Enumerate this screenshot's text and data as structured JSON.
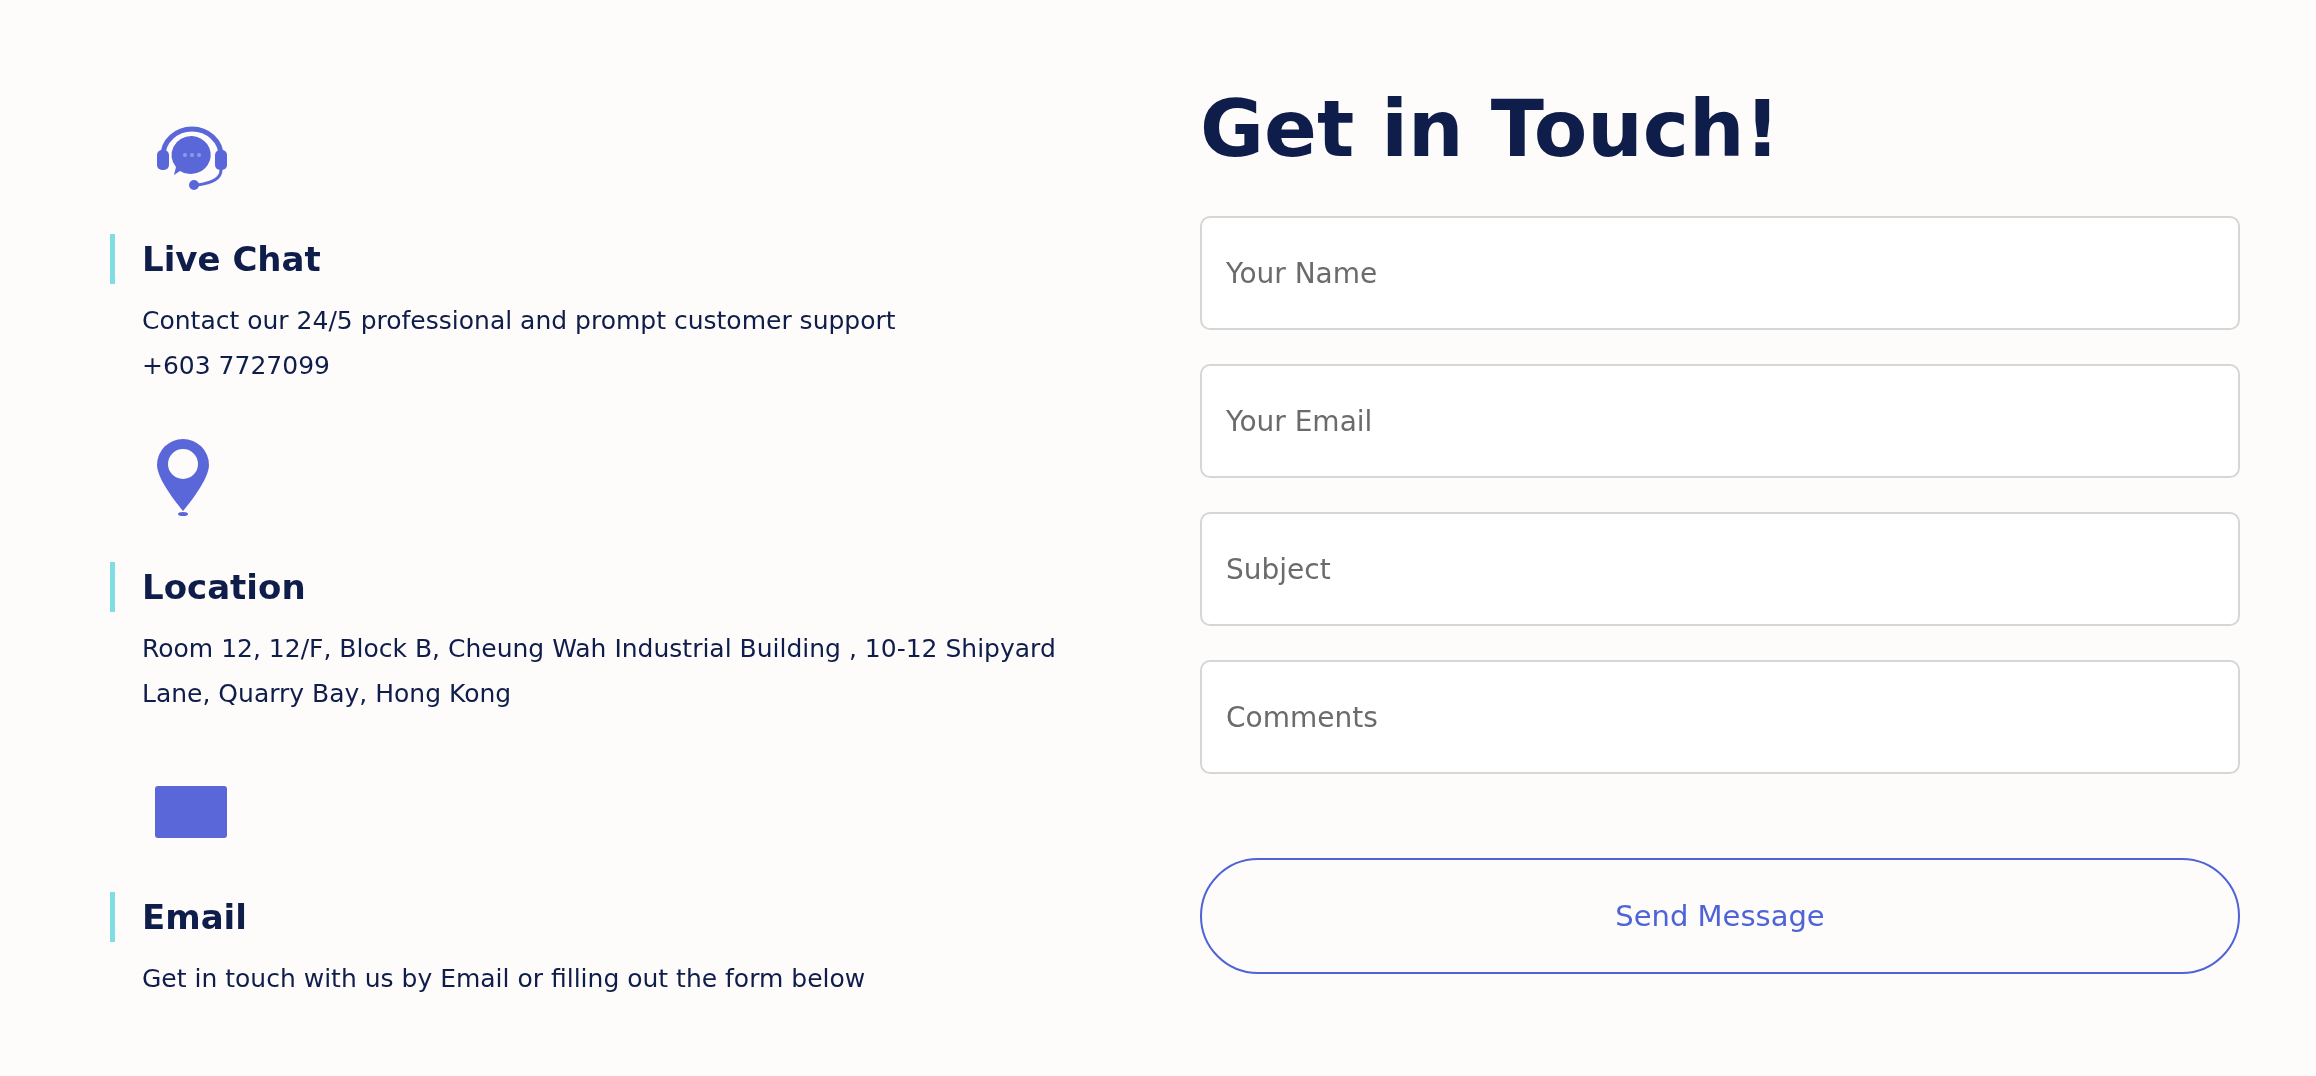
{
  "contacts": [
    {
      "kind": "chat",
      "title": "Live Chat",
      "lines": [
        "Contact our 24/5 professional and prompt customer support",
        "+603 7727099"
      ]
    },
    {
      "kind": "location",
      "title": "Location",
      "lines": [
        "Room 12, 12/F, Block B, Cheung Wah Industrial Building , 10-12 Shipyard Lane, Quarry Bay, Hong Kong"
      ]
    },
    {
      "kind": "email",
      "title": "Email",
      "lines": [
        "Get in touch with us by Email or filling out the form below"
      ]
    }
  ],
  "form": {
    "title": "Get in Touch!",
    "fields": [
      {
        "placeholder": "Your Name"
      },
      {
        "placeholder": "Your Email"
      },
      {
        "placeholder": "Subject"
      },
      {
        "placeholder": "Comments"
      }
    ],
    "submit": "Send Message"
  }
}
